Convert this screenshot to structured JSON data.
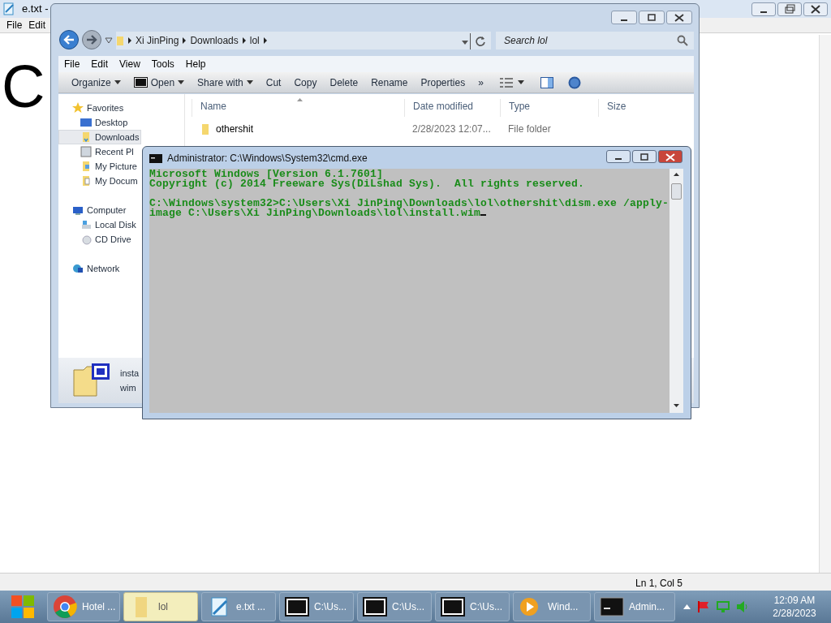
{
  "notepad": {
    "title": "e.txt -",
    "menu": [
      "File",
      "Edit"
    ],
    "content": "C",
    "status": "Ln 1, Col 5"
  },
  "explorer": {
    "breadcrumb": [
      "Xi JinPing",
      "Downloads",
      "lol"
    ],
    "search": {
      "placeholder": "Search lol"
    },
    "menu": [
      "File",
      "Edit",
      "View",
      "Tools",
      "Help"
    ],
    "toolbar": [
      {
        "label": "Organize",
        "kind": "dropdown"
      },
      {
        "label": "Open",
        "kind": "archive"
      },
      {
        "label": "Share with",
        "kind": "dropdown"
      },
      {
        "label": "Cut",
        "kind": "button"
      },
      {
        "label": "Copy",
        "kind": "button"
      },
      {
        "label": "Delete",
        "kind": "button"
      },
      {
        "label": "Rename",
        "kind": "button"
      },
      {
        "label": "Properties",
        "kind": "button"
      },
      {
        "label": "»",
        "kind": "more"
      }
    ],
    "nav": [
      {
        "label": "Favorites",
        "kind": "star",
        "selected": false,
        "children": [
          {
            "label": "Desktop",
            "kind": "desktop",
            "selected": false
          },
          {
            "label": "Downloads",
            "kind": "folder",
            "selected": true
          },
          {
            "label": "Recent Pl",
            "kind": "recent",
            "selected": false
          },
          {
            "label": "My Picture",
            "kind": "pictures",
            "selected": false
          },
          {
            "label": "My Docum",
            "kind": "docs",
            "selected": false
          }
        ]
      },
      {
        "label": "Computer",
        "kind": "computer",
        "selected": false,
        "children": [
          {
            "label": "Local Disk",
            "kind": "disk",
            "selected": false
          },
          {
            "label": "CD Drive",
            "kind": "cd",
            "selected": false
          }
        ]
      },
      {
        "label": "Network",
        "kind": "network",
        "selected": false
      }
    ],
    "columns": [
      "Name",
      "Date modified",
      "Type",
      "Size"
    ],
    "rows": [
      {
        "name": "othershit",
        "date_modified": "2/28/2023 12:07...",
        "type": "File folder"
      }
    ],
    "details": [
      "insta",
      "wim"
    ]
  },
  "cmd": {
    "title": "Administrator: C:\\Windows\\System32\\cmd.exe",
    "blocks": [
      [
        "Microsoft Windows [Version 6.1.7601]",
        "Copyright (c) 2014 Freeware Sys(DiLshad Sys).  All rights reserved."
      ],
      [
        "C:\\Windows\\system32>C:\\Users\\Xi JinPing\\Downloads\\lol\\othershit\\dism.exe /apply-",
        "image C:\\Users\\Xi JinPing\\Downloads\\lol\\install.wim"
      ]
    ]
  },
  "taskbar": {
    "items": [
      {
        "label": "Hotel ...",
        "kind": "chrome",
        "selected": false
      },
      {
        "label": "lol",
        "kind": "folder",
        "selected": true
      },
      {
        "label": "e.txt ...",
        "kind": "notepad",
        "selected": false
      },
      {
        "label": "C:\\Us...",
        "kind": "archive",
        "selected": false
      },
      {
        "label": "C:\\Us...",
        "kind": "archive",
        "selected": false
      },
      {
        "label": "C:\\Us...",
        "kind": "archive",
        "selected": false
      },
      {
        "label": "Wind...",
        "kind": "media",
        "selected": false
      },
      {
        "label": "Admin...",
        "kind": "cmd",
        "selected": false
      }
    ],
    "clock": {
      "time": "12:09 AM",
      "date": "2/28/2023"
    }
  }
}
